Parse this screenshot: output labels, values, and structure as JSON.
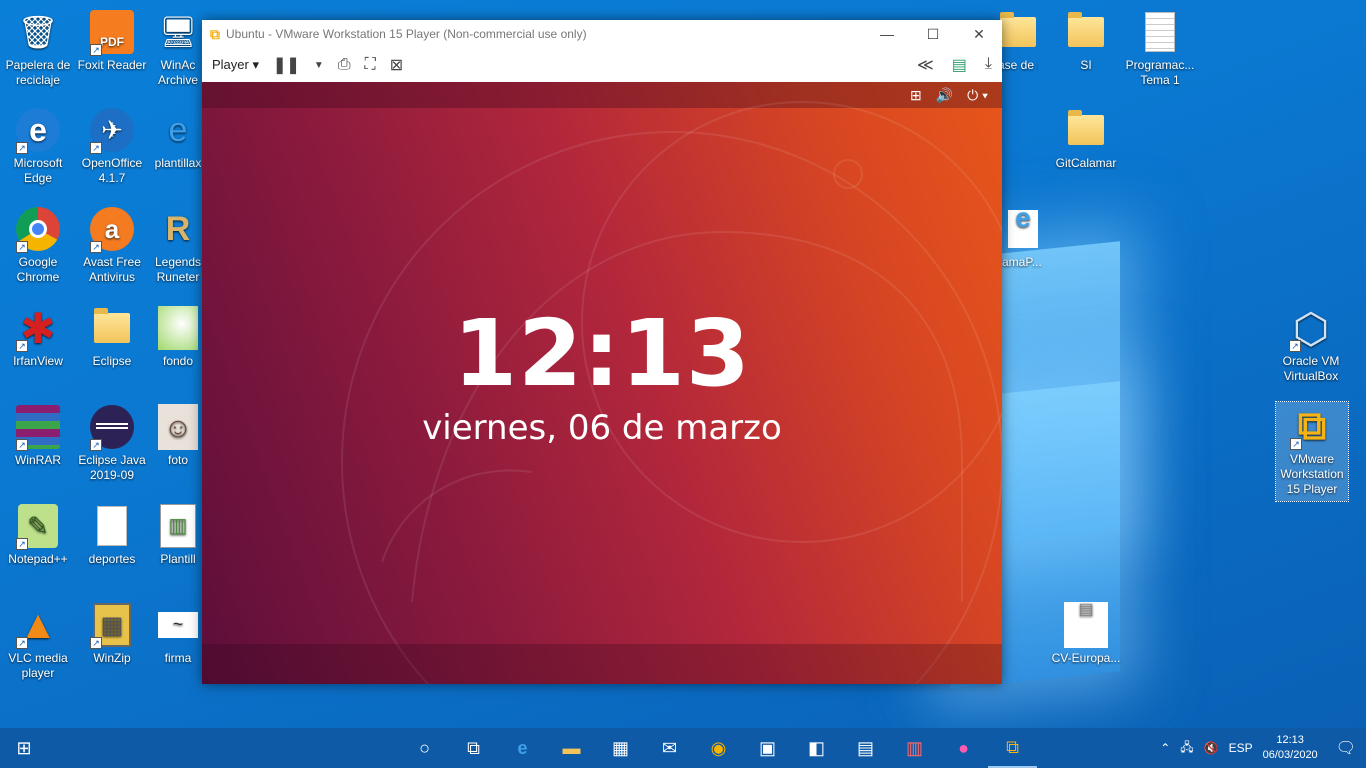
{
  "desktop": {
    "icons": [
      {
        "label": "Papelera de reciclaje",
        "glyph": "🗑"
      },
      {
        "label": "Foxit Reader",
        "glyph": "PDF"
      },
      {
        "label": "WinAc Archive",
        "glyph": "🖥"
      },
      {
        "label": "Microsoft Edge",
        "glyph": "e"
      },
      {
        "label": "OpenOffice 4.1.7",
        "glyph": "✈"
      },
      {
        "label": "plantillax",
        "glyph": "e"
      },
      {
        "label": "Google Chrome",
        "glyph": "◉"
      },
      {
        "label": "Avast Free Antivirus",
        "glyph": "a"
      },
      {
        "label": "Legends Runeter",
        "glyph": "R"
      },
      {
        "label": "IrfanView",
        "glyph": "✱"
      },
      {
        "label": "Eclipse",
        "glyph": ""
      },
      {
        "label": "fondo",
        "glyph": ""
      },
      {
        "label": "WinRAR",
        "glyph": "▤"
      },
      {
        "label": "Eclipse Java 2019-09",
        "glyph": "◐"
      },
      {
        "label": "foto",
        "glyph": "☺"
      },
      {
        "label": "Notepad++",
        "glyph": "✎"
      },
      {
        "label": "deportes",
        "glyph": ""
      },
      {
        "label": "Plantill",
        "glyph": "▥"
      },
      {
        "label": "VLC media player",
        "glyph": "▲"
      },
      {
        "label": "WinZip",
        "glyph": "▦"
      },
      {
        "label": "firma",
        "glyph": "~"
      },
      {
        "label": "ase de atos",
        "glyph": ""
      },
      {
        "label": "SI",
        "glyph": ""
      },
      {
        "label": "Programac... Tema 1",
        "glyph": ""
      },
      {
        "label": "GitCalamar",
        "glyph": ""
      },
      {
        "label": "ramaP...",
        "glyph": "e"
      },
      {
        "label": "Oracle VM VirtualBox",
        "glyph": "⬡"
      },
      {
        "label": "VMware Workstation 15 Player",
        "glyph": "⧉"
      },
      {
        "label": "CV-Europa...",
        "glyph": "▤"
      }
    ]
  },
  "vm_window": {
    "title": "Ubuntu - VMware Workstation 15 Player (Non-commercial use only)",
    "menu_player": "Player",
    "ubuntu": {
      "time": "12:13",
      "date": "viernes, 06 de marzo"
    }
  },
  "taskbar": {
    "lang": "ESP",
    "time": "12:13",
    "date": "06/03/2020"
  }
}
